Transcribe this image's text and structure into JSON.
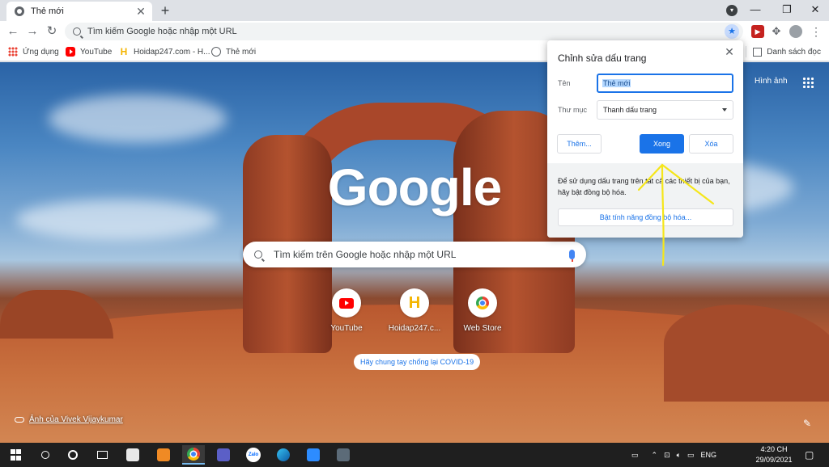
{
  "browser": {
    "tab_title": "Thẻ mới",
    "tab_close": "✕",
    "new_tab": "+",
    "window_minimize": "—",
    "window_restore": "❐",
    "window_close": "✕",
    "omnibox_placeholder": "Tìm kiếm Google hoặc nhập một URL"
  },
  "bookmarks_bar": {
    "items": [
      {
        "label": "Ứng dụng",
        "icon": "apps-grid-icon"
      },
      {
        "label": "YouTube",
        "icon": "youtube-icon"
      },
      {
        "label": "Hoidap247.com - H...",
        "icon": "hoidap-icon"
      },
      {
        "label": "Thẻ mới",
        "icon": "globe-icon"
      }
    ],
    "reading_list": "Danh sách đọc"
  },
  "ntp": {
    "logo": "Google",
    "search_placeholder": "Tìm kiếm trên Google hoặc nhập một URL",
    "images_link": "Hình ảnh",
    "shortcuts": [
      {
        "label": "YouTube",
        "icon": "youtube-icon"
      },
      {
        "label": "Hoidap247.c...",
        "icon": "hoidap-icon"
      },
      {
        "label": "Web Store",
        "icon": "web-store-icon"
      }
    ],
    "covid_chip": "Hãy chung tay chống lại COVID-19",
    "photo_credit": "Ảnh của Vivek Vijaykumar"
  },
  "bookmark_dialog": {
    "title": "Chỉnh sửa dấu trang",
    "name_label": "Tên",
    "name_value": "Thẻ mới",
    "folder_label": "Thư mục",
    "folder_value": "Thanh dấu trang",
    "more_button": "Thêm...",
    "done_button": "Xong",
    "remove_button": "Xóa",
    "sync_text": "Để sử dụng dấu trang trên tất cả các thiết bị của bạn, hãy bật đồng bộ hóa.",
    "sync_button": "Bật tính năng đồng bộ hóa..."
  },
  "taskbar": {
    "language": "ENG",
    "time": "4:20 CH",
    "date": "29/09/2021",
    "zalo_label": "Zalo"
  },
  "colors": {
    "accent": "#1a73e8",
    "annotation": "#f5e61a"
  }
}
